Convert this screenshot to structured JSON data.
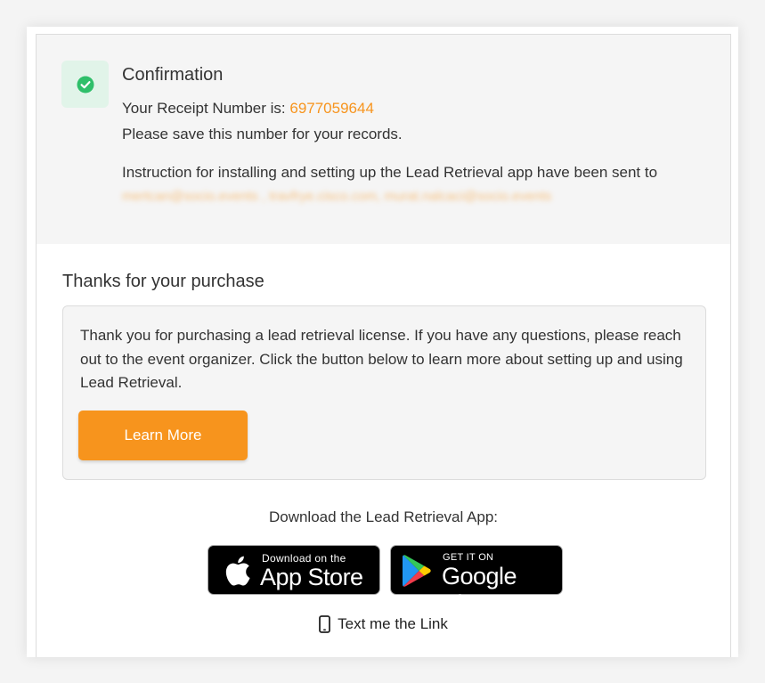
{
  "confirmation": {
    "title": "Confirmation",
    "receipt_label": "Your Receipt Number is:",
    "receipt_number": "6977059644",
    "save_note": "Please save this number for your records.",
    "instructions": "Instruction for installing and setting up the Lead Retrieval app have been sent to",
    "emails": "mertcan@socio.events , travfrye.cisco.com, murat.nalcaci@socio.events"
  },
  "thanks": {
    "title": "Thanks for your purchase",
    "message": "Thank you for purchasing a lead retrieval license. If you have any questions, please reach out to the event organizer. Click the button below to learn more about setting up and using Lead Retrieval.",
    "learn_more_label": "Learn More"
  },
  "download": {
    "label": "Download the Lead Retrieval App:",
    "app_store": {
      "small": "Download on the",
      "big": "App Store"
    },
    "google_play": {
      "small": "GET IT ON",
      "big": "Google Play"
    },
    "text_link": "Text me the Link"
  },
  "colors": {
    "accent": "#f7941d",
    "success": "#2fbf6a",
    "success_bg": "#e1f4e9"
  },
  "icons": [
    "check-circle-icon",
    "apple-icon",
    "google-play-icon",
    "phone-icon"
  ]
}
